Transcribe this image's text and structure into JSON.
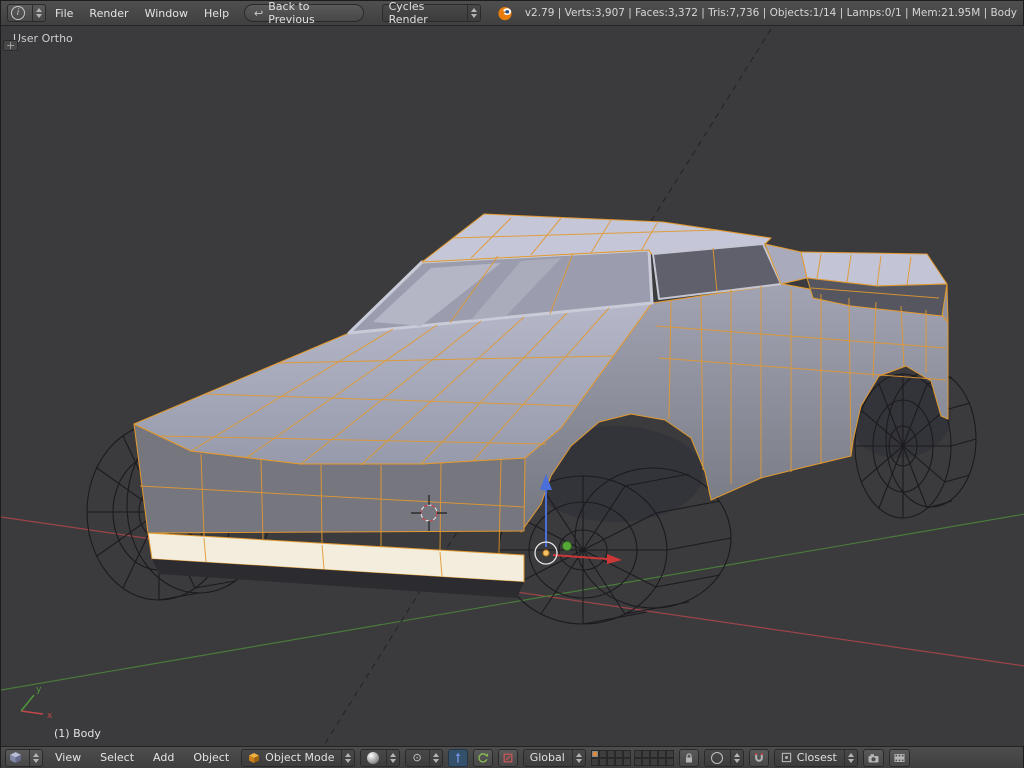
{
  "top_bar": {
    "menus": [
      "File",
      "Render",
      "Window",
      "Help"
    ],
    "back_label": "Back to Previous",
    "engine": "Cycles Render",
    "stats": "v2.79 | Verts:3,907 | Faces:3,372 | Tris:7,736 | Objects:1/14 | Lamps:0/1 | Mem:21.95M | Body"
  },
  "viewport": {
    "view_label": "User Ortho",
    "object_label": "(1) Body",
    "wireframe_color": "#e2992f",
    "axis_x_color": "#9c4448",
    "axis_y_color": "#4a7a3a"
  },
  "bottom_bar": {
    "menus": [
      "View",
      "Select",
      "Add",
      "Object"
    ],
    "mode_label": "Object Mode",
    "orientation_label": "Global",
    "snap_label": "Closest"
  },
  "icons": {
    "info": "i",
    "back_arrow": "↩",
    "expand_plus": "+",
    "pivot": "⊙",
    "axis_x_label": "x",
    "axis_y_label": "y"
  },
  "layers": {
    "count": 20,
    "active_index": 0
  }
}
